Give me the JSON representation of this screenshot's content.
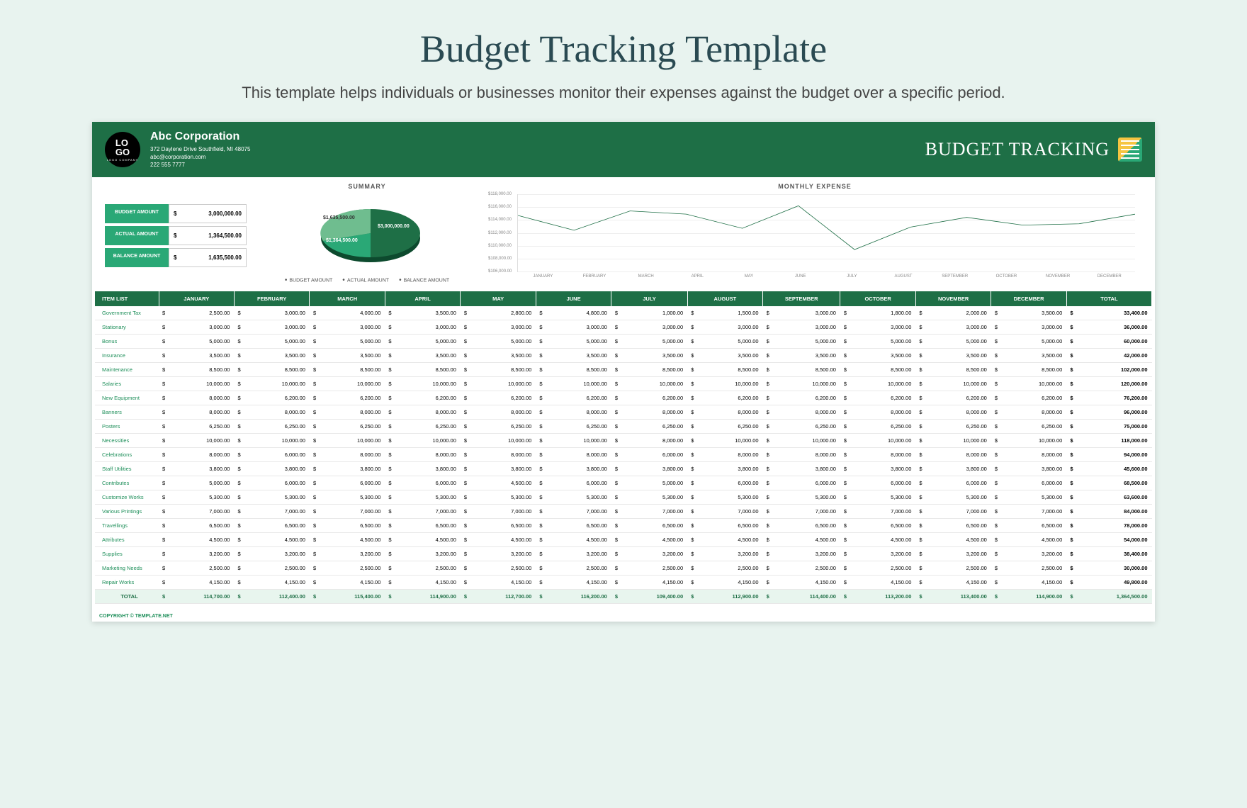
{
  "page": {
    "title": "Budget Tracking Template",
    "description": "This template helps individuals or businesses monitor their expenses against the budget over a specific period."
  },
  "header": {
    "logo_text": "LO GO",
    "logo_sub": "LOGO COMPANY",
    "company": "Abc Corporation",
    "address": "372 Daylene Drive Southfield, MI 48075",
    "email": "abc@corporation.com",
    "phone": "222 555 7777",
    "title": "BUDGET TRACKING"
  },
  "summary": {
    "section_label": "SUMMARY",
    "budget_label": "BUDGET AMOUNT",
    "budget_value": "3,000,000.00",
    "actual_label": "ACTUAL AMOUNT",
    "actual_value": "1,364,500.00",
    "balance_label": "BALANCE AMOUNT",
    "balance_value": "1,635,500.00",
    "legend_budget": "BUDGET AMOUNT",
    "legend_actual": "ACTUAL AMOUNT",
    "legend_balance": "BALANCE AMOUNT",
    "pie_budget": "$3,000,000.00",
    "pie_actual": "$1,364,500.00",
    "pie_balance": "$1,635,500.00"
  },
  "monthly": {
    "label": "MONTHLY EXPENSE",
    "yticks": [
      "$118,000.00",
      "$116,000.00",
      "$114,000.00",
      "$112,000.00",
      "$110,000.00",
      "$108,000.00",
      "$106,000.00"
    ],
    "months": [
      "JANUARY",
      "FEBRUARY",
      "MARCH",
      "APRIL",
      "MAY",
      "JUNE",
      "JULY",
      "AUGUST",
      "SEPTEMBER",
      "OCTOBER",
      "NOVEMBER",
      "DECEMBER"
    ]
  },
  "table": {
    "headers": [
      "ITEM LIST",
      "JANUARY",
      "FEBRUARY",
      "MARCH",
      "APRIL",
      "MAY",
      "JUNE",
      "JULY",
      "AUGUST",
      "SEPTEMBER",
      "OCTOBER",
      "NOVEMBER",
      "DECEMBER",
      "TOTAL"
    ],
    "rows": [
      {
        "item": "Government Tax",
        "vals": [
          "2,500.00",
          "3,000.00",
          "4,000.00",
          "3,500.00",
          "2,800.00",
          "4,800.00",
          "1,000.00",
          "1,500.00",
          "3,000.00",
          "1,800.00",
          "2,000.00",
          "3,500.00"
        ],
        "total": "33,400.00"
      },
      {
        "item": "Stationary",
        "vals": [
          "3,000.00",
          "3,000.00",
          "3,000.00",
          "3,000.00",
          "3,000.00",
          "3,000.00",
          "3,000.00",
          "3,000.00",
          "3,000.00",
          "3,000.00",
          "3,000.00",
          "3,000.00"
        ],
        "total": "36,000.00"
      },
      {
        "item": "Bonus",
        "vals": [
          "5,000.00",
          "5,000.00",
          "5,000.00",
          "5,000.00",
          "5,000.00",
          "5,000.00",
          "5,000.00",
          "5,000.00",
          "5,000.00",
          "5,000.00",
          "5,000.00",
          "5,000.00"
        ],
        "total": "60,000.00"
      },
      {
        "item": "Insurance",
        "vals": [
          "3,500.00",
          "3,500.00",
          "3,500.00",
          "3,500.00",
          "3,500.00",
          "3,500.00",
          "3,500.00",
          "3,500.00",
          "3,500.00",
          "3,500.00",
          "3,500.00",
          "3,500.00"
        ],
        "total": "42,000.00"
      },
      {
        "item": "Maintenance",
        "vals": [
          "8,500.00",
          "8,500.00",
          "8,500.00",
          "8,500.00",
          "8,500.00",
          "8,500.00",
          "8,500.00",
          "8,500.00",
          "8,500.00",
          "8,500.00",
          "8,500.00",
          "8,500.00"
        ],
        "total": "102,000.00"
      },
      {
        "item": "Salaries",
        "vals": [
          "10,000.00",
          "10,000.00",
          "10,000.00",
          "10,000.00",
          "10,000.00",
          "10,000.00",
          "10,000.00",
          "10,000.00",
          "10,000.00",
          "10,000.00",
          "10,000.00",
          "10,000.00"
        ],
        "total": "120,000.00"
      },
      {
        "item": "New Equipment",
        "vals": [
          "8,000.00",
          "6,200.00",
          "6,200.00",
          "6,200.00",
          "6,200.00",
          "6,200.00",
          "6,200.00",
          "6,200.00",
          "6,200.00",
          "6,200.00",
          "6,200.00",
          "6,200.00"
        ],
        "total": "76,200.00"
      },
      {
        "item": "Banners",
        "vals": [
          "8,000.00",
          "8,000.00",
          "8,000.00",
          "8,000.00",
          "8,000.00",
          "8,000.00",
          "8,000.00",
          "8,000.00",
          "8,000.00",
          "8,000.00",
          "8,000.00",
          "8,000.00"
        ],
        "total": "96,000.00"
      },
      {
        "item": "Posters",
        "vals": [
          "6,250.00",
          "6,250.00",
          "6,250.00",
          "6,250.00",
          "6,250.00",
          "6,250.00",
          "6,250.00",
          "6,250.00",
          "6,250.00",
          "6,250.00",
          "6,250.00",
          "6,250.00"
        ],
        "total": "75,000.00"
      },
      {
        "item": "Necessities",
        "vals": [
          "10,000.00",
          "10,000.00",
          "10,000.00",
          "10,000.00",
          "10,000.00",
          "10,000.00",
          "8,000.00",
          "10,000.00",
          "10,000.00",
          "10,000.00",
          "10,000.00",
          "10,000.00"
        ],
        "total": "118,000.00"
      },
      {
        "item": "Celebrations",
        "vals": [
          "8,000.00",
          "6,000.00",
          "8,000.00",
          "8,000.00",
          "8,000.00",
          "8,000.00",
          "6,000.00",
          "8,000.00",
          "8,000.00",
          "8,000.00",
          "8,000.00",
          "8,000.00"
        ],
        "total": "94,000.00"
      },
      {
        "item": "Staff Utilities",
        "vals": [
          "3,800.00",
          "3,800.00",
          "3,800.00",
          "3,800.00",
          "3,800.00",
          "3,800.00",
          "3,800.00",
          "3,800.00",
          "3,800.00",
          "3,800.00",
          "3,800.00",
          "3,800.00"
        ],
        "total": "45,600.00"
      },
      {
        "item": "Contributes",
        "vals": [
          "5,000.00",
          "6,000.00",
          "6,000.00",
          "6,000.00",
          "4,500.00",
          "6,000.00",
          "5,000.00",
          "6,000.00",
          "6,000.00",
          "6,000.00",
          "6,000.00",
          "6,000.00"
        ],
        "total": "68,500.00"
      },
      {
        "item": "Customize Works",
        "vals": [
          "5,300.00",
          "5,300.00",
          "5,300.00",
          "5,300.00",
          "5,300.00",
          "5,300.00",
          "5,300.00",
          "5,300.00",
          "5,300.00",
          "5,300.00",
          "5,300.00",
          "5,300.00"
        ],
        "total": "63,600.00"
      },
      {
        "item": "Various Printings",
        "vals": [
          "7,000.00",
          "7,000.00",
          "7,000.00",
          "7,000.00",
          "7,000.00",
          "7,000.00",
          "7,000.00",
          "7,000.00",
          "7,000.00",
          "7,000.00",
          "7,000.00",
          "7,000.00"
        ],
        "total": "84,000.00"
      },
      {
        "item": "Travellings",
        "vals": [
          "6,500.00",
          "6,500.00",
          "6,500.00",
          "6,500.00",
          "6,500.00",
          "6,500.00",
          "6,500.00",
          "6,500.00",
          "6,500.00",
          "6,500.00",
          "6,500.00",
          "6,500.00"
        ],
        "total": "78,000.00"
      },
      {
        "item": "Attributes",
        "vals": [
          "4,500.00",
          "4,500.00",
          "4,500.00",
          "4,500.00",
          "4,500.00",
          "4,500.00",
          "4,500.00",
          "4,500.00",
          "4,500.00",
          "4,500.00",
          "4,500.00",
          "4,500.00"
        ],
        "total": "54,000.00"
      },
      {
        "item": "Supplies",
        "vals": [
          "3,200.00",
          "3,200.00",
          "3,200.00",
          "3,200.00",
          "3,200.00",
          "3,200.00",
          "3,200.00",
          "3,200.00",
          "3,200.00",
          "3,200.00",
          "3,200.00",
          "3,200.00"
        ],
        "total": "38,400.00"
      },
      {
        "item": "Marketing Needs",
        "vals": [
          "2,500.00",
          "2,500.00",
          "2,500.00",
          "2,500.00",
          "2,500.00",
          "2,500.00",
          "2,500.00",
          "2,500.00",
          "2,500.00",
          "2,500.00",
          "2,500.00",
          "2,500.00"
        ],
        "total": "30,000.00"
      },
      {
        "item": "Repair Works",
        "vals": [
          "4,150.00",
          "4,150.00",
          "4,150.00",
          "4,150.00",
          "4,150.00",
          "4,150.00",
          "4,150.00",
          "4,150.00",
          "4,150.00",
          "4,150.00",
          "4,150.00",
          "4,150.00"
        ],
        "total": "49,800.00"
      }
    ],
    "totals": {
      "label": "TOTAL",
      "vals": [
        "114,700.00",
        "112,400.00",
        "115,400.00",
        "114,900.00",
        "112,700.00",
        "116,200.00",
        "109,400.00",
        "112,900.00",
        "114,400.00",
        "113,200.00",
        "113,400.00",
        "114,900.00"
      ],
      "grand": "1,364,500.00"
    }
  },
  "chart_data": [
    {
      "type": "pie",
      "title": "SUMMARY",
      "series": [
        {
          "name": "BUDGET AMOUNT",
          "value": 3000000
        },
        {
          "name": "ACTUAL AMOUNT",
          "value": 1364500
        },
        {
          "name": "BALANCE AMOUNT",
          "value": 1635500
        }
      ]
    },
    {
      "type": "line",
      "title": "MONTHLY EXPENSE",
      "categories": [
        "JANUARY",
        "FEBRUARY",
        "MARCH",
        "APRIL",
        "MAY",
        "JUNE",
        "JULY",
        "AUGUST",
        "SEPTEMBER",
        "OCTOBER",
        "NOVEMBER",
        "DECEMBER"
      ],
      "values": [
        114700,
        112400,
        115400,
        114900,
        112700,
        116200,
        109400,
        112900,
        114400,
        113200,
        113400,
        114900
      ],
      "ylim": [
        106000,
        118000
      ],
      "ylabel": "",
      "xlabel": ""
    }
  ],
  "copyright": "COPYRIGHT © TEMPLATE.NET"
}
